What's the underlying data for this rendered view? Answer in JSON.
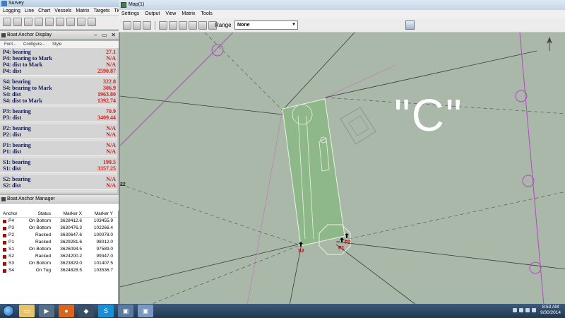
{
  "survey": {
    "title": "Survey",
    "menu": [
      "Logging",
      "Line",
      "Chart",
      "Vessels",
      "Matrix",
      "Targets",
      "Tide"
    ]
  },
  "boat_anchor_display": {
    "title": "Boat Anchor Display",
    "subtoolbar": [
      "Font...",
      "Configure...",
      "Style"
    ],
    "groups": [
      [
        {
          "label": "P4: bearing",
          "value": "27.1"
        },
        {
          "label": "P4: bearing to Mark",
          "value": "N/A"
        },
        {
          "label": "P4: dist to Mark",
          "value": "N/A"
        },
        {
          "label": "P4: dist",
          "value": "2590.87"
        }
      ],
      [
        {
          "label": "S4: bearing",
          "value": "322.8"
        },
        {
          "label": "S4: bearing to Mark",
          "value": "306.9"
        },
        {
          "label": "S4: dist",
          "value": "1963.80"
        },
        {
          "label": "S4: dist to Mark",
          "value": "1392.74"
        }
      ],
      [
        {
          "label": "P3: bearing",
          "value": "70.9"
        },
        {
          "label": "P3: dist",
          "value": "3409.44"
        }
      ],
      [
        {
          "label": "P2: bearing",
          "value": "N/A"
        },
        {
          "label": "P2: dist",
          "value": "N/A"
        }
      ],
      [
        {
          "label": "P1: bearing",
          "value": "N/A"
        },
        {
          "label": "P1: dist",
          "value": "N/A"
        }
      ],
      [
        {
          "label": "S1: bearing",
          "value": "199.5"
        },
        {
          "label": "S1: dist",
          "value": "3357.25"
        }
      ],
      [
        {
          "label": "S2: bearing",
          "value": "N/A"
        },
        {
          "label": "S2: dist",
          "value": "N/A"
        }
      ],
      [
        {
          "label": "S3: bearing",
          "value": "275.0"
        },
        {
          "label": "S3: dist",
          "value": "3317.81"
        }
      ]
    ]
  },
  "boat_anchor_manager": {
    "title": "Boat Anchor Manager",
    "columns": [
      "Anchor",
      "Status",
      "Marker X",
      "Marker Y"
    ],
    "rows": [
      {
        "anchor": "P4",
        "status": "On Bottom",
        "x": "3628412.6",
        "y": "103455.9"
      },
      {
        "anchor": "P3",
        "status": "On Bottom",
        "x": "3630476.3",
        "y": "102266.4"
      },
      {
        "anchor": "P2",
        "status": "Racked",
        "x": "3630647.6",
        "y": "100078.0"
      },
      {
        "anchor": "P1",
        "status": "Racked",
        "x": "3629281.6",
        "y": "98012.0"
      },
      {
        "anchor": "S1",
        "status": "On Bottom",
        "x": "3626094.5",
        "y": "97589.0"
      },
      {
        "anchor": "S2",
        "status": "Racked",
        "x": "3624200.2",
        "y": "99347.0"
      },
      {
        "anchor": "S3",
        "status": "On Bottom",
        "x": "3623829.0",
        "y": "101407.5"
      },
      {
        "anchor": "S4",
        "status": "On Tug",
        "x": "3624828.5",
        "y": "103536.7"
      }
    ]
  },
  "map": {
    "title": "Map(1)",
    "menu": [
      "Settings",
      "Output",
      "View",
      "Matrix",
      "Tools"
    ],
    "range_label": "Range",
    "range_value": "None",
    "big_label": "\"C\"",
    "edge_label": "22",
    "marker_labels": {
      "s2": "S2",
      "p1": "P1",
      "p2": "P2"
    }
  },
  "taskbar": {
    "time": "8:53 AM",
    "date": "9/30/2014"
  },
  "colors": {
    "map_bg": "#a9b8a9",
    "barge_fill": "#8fb88a",
    "value_red": "#c8201a",
    "anchor_line_magenta": "#b04ac0"
  }
}
